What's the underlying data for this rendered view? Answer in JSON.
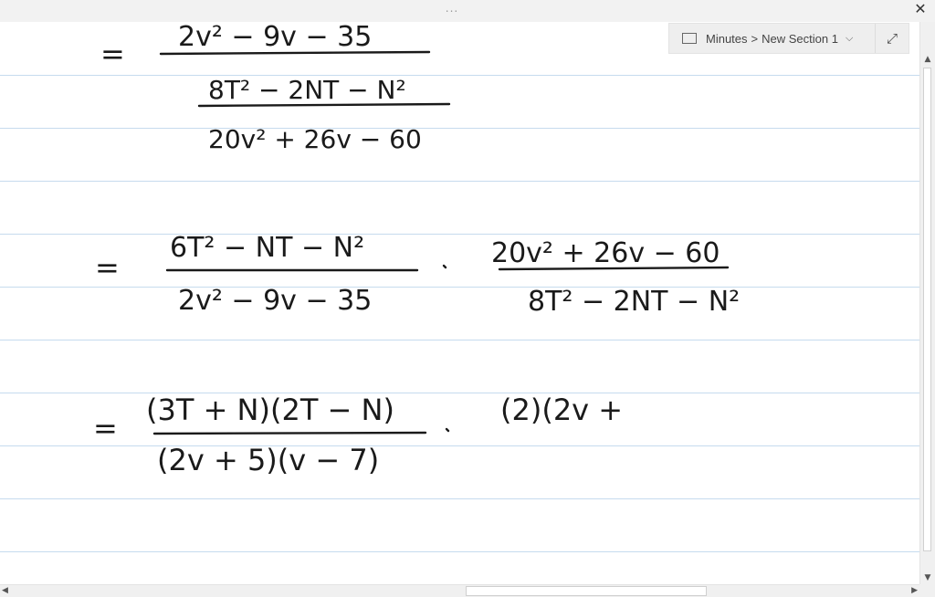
{
  "window": {
    "drag_handle": "...",
    "close_glyph": "✕"
  },
  "navigation": {
    "notebook": "Minutes",
    "separator": ">",
    "section": "New Section 1",
    "chevron_glyph": "⌵",
    "expand_glyph": "⤢"
  },
  "notes": {
    "eq1": {
      "equals": "=",
      "numerator": "2v² − 9v − 35",
      "line2": "8T² − 2NT − N²",
      "line3": "20v² + 26v − 60"
    },
    "eq2": {
      "equals": "=",
      "left_numerator": "6T² − NT − N²",
      "left_denominator": "2v² − 9v − 35",
      "right_numerator": "20v² + 26v − 60",
      "right_denominator": "8T² − 2NT − N²"
    },
    "eq3": {
      "equals": "=",
      "numerator": "(3T + N)(2T − N)",
      "denominator": "(2v + 5)(v − 7)",
      "partial": "(2)(2v +"
    }
  },
  "scrollbars": {
    "up": "▲",
    "down": "▼",
    "left": "◀",
    "right": "▶"
  }
}
